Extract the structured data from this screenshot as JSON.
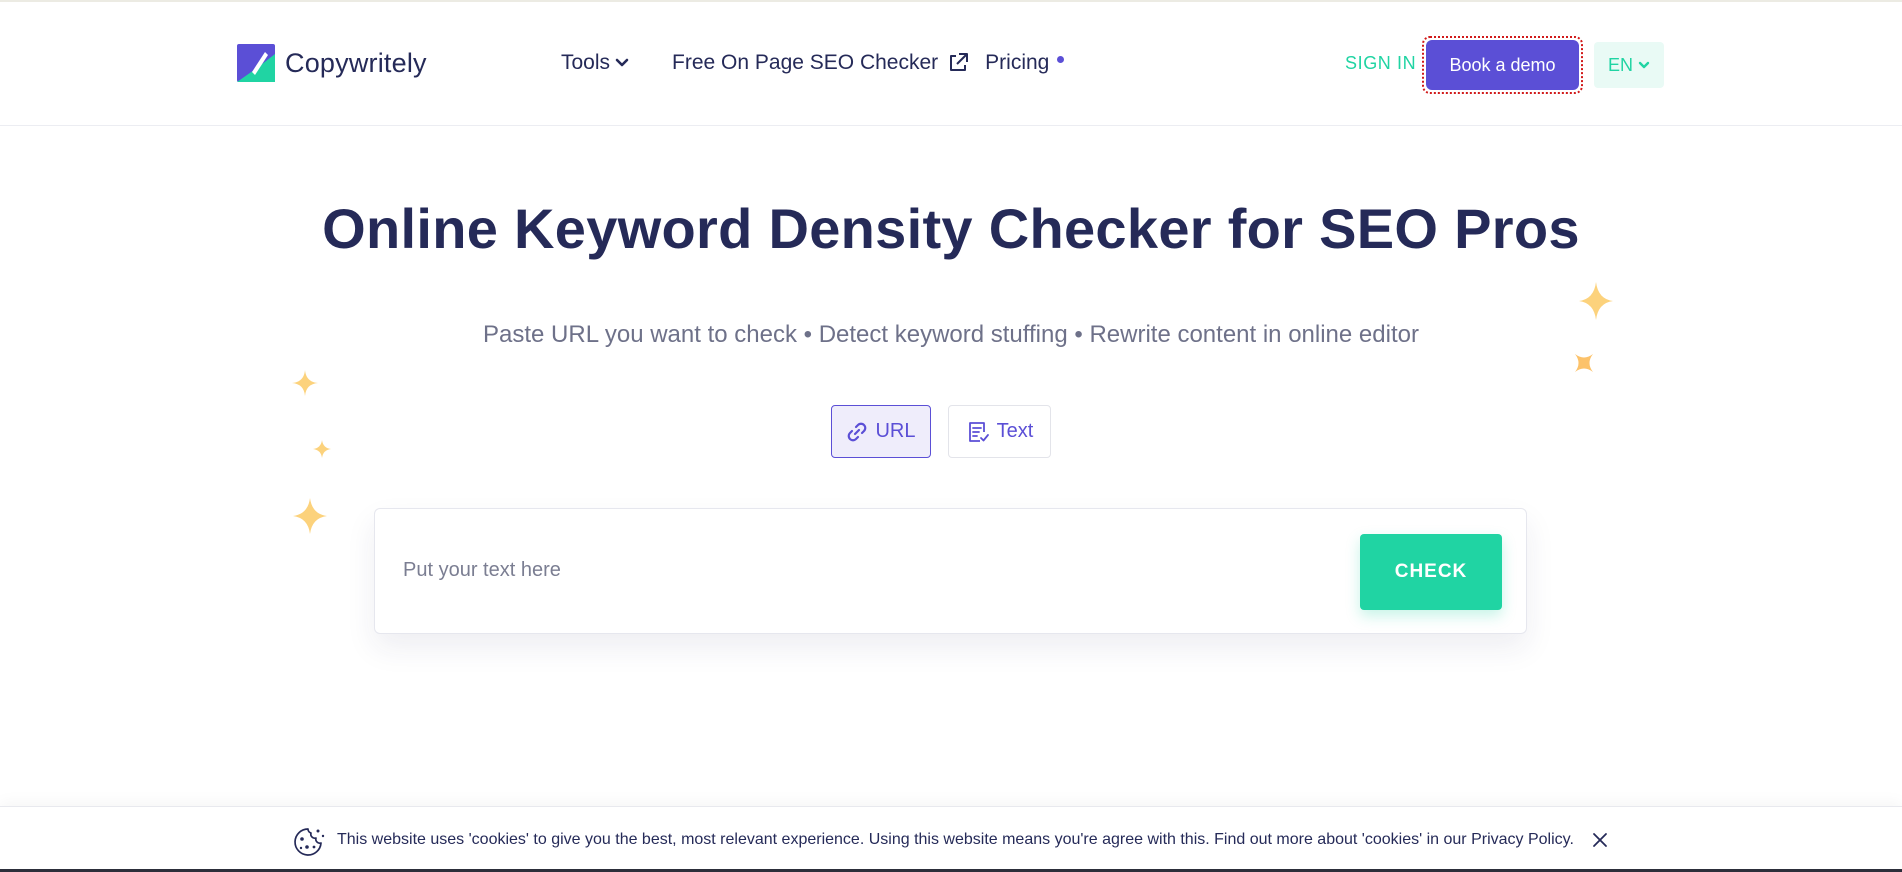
{
  "header": {
    "logo_text": "Copywritely",
    "nav": {
      "tools": "Tools",
      "seo_checker": "Free On Page SEO Checker",
      "pricing": "Pricing"
    },
    "sign_in": "SIGN IN",
    "book_demo": "Book a demo",
    "language": "EN"
  },
  "hero": {
    "title": "Online Keyword Density Checker for SEO Pros",
    "subtitle": "Paste URL you want to check • Detect keyword stuffing • Rewrite content in online editor"
  },
  "mode_toggle": {
    "url_label": "URL",
    "text_label": "Text",
    "selected": "URL"
  },
  "input": {
    "value": "",
    "placeholder": "Put your text here"
  },
  "check_label": "CHECK",
  "cookie": {
    "message": "This website uses 'cookies' to give you the best, most relevant experience. Using this website means you're agree with this. Find out more about 'cookies' in our Privacy Policy."
  },
  "colors": {
    "primary": "#5b4fd6",
    "accent": "#20d4a3",
    "text_dark": "#252a58",
    "text_muted": "#6e7189",
    "sparkle": "#fcd27c"
  },
  "icons": {
    "tools_chevron": "chevron-down-icon",
    "seo_link": "external-link-icon",
    "pricing_dot": "dot-icon",
    "url_toggle": "link-icon",
    "text_toggle": "document-check-icon",
    "cookie": "cookie-icon",
    "close": "close-icon"
  }
}
